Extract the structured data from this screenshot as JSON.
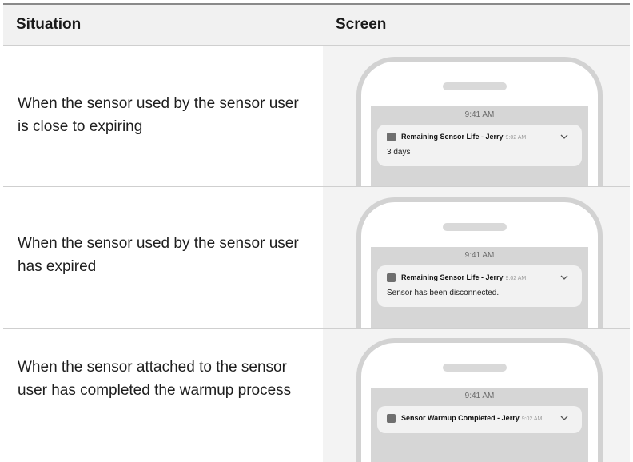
{
  "table": {
    "headers": {
      "situation": "Situation",
      "screen": "Screen"
    },
    "rows": [
      {
        "situation": "When the sensor used by the sensor user is close to expiring",
        "clock": "9:41 AM",
        "notification_title": "Remaining Sensor Life - Jerry",
        "notification_time": "9:02 AM",
        "notification_body": "3 days"
      },
      {
        "situation": "When the sensor used by the sensor user has expired",
        "clock": "9:41 AM",
        "notification_title": "Remaining Sensor Life - Jerry",
        "notification_time": "9:02 AM",
        "notification_body": "Sensor has been disconnected."
      },
      {
        "situation": "When the sensor attached to the sensor user has completed the warmup process",
        "clock": "9:41 AM",
        "notification_title": "Sensor Warmup Completed - Jerry",
        "notification_time": "9:02 AM",
        "notification_body": ""
      }
    ]
  },
  "colors": {
    "header_bg": "#f1f1f1",
    "screen_bg": "#f3f3f3",
    "phone_frame": "#d2d2d2",
    "lockscreen_bg": "#d6d6d6",
    "notification_bg": "#f2f2f2"
  },
  "icons": {
    "app": "app-square-icon",
    "expand": "chevron-down-icon"
  }
}
